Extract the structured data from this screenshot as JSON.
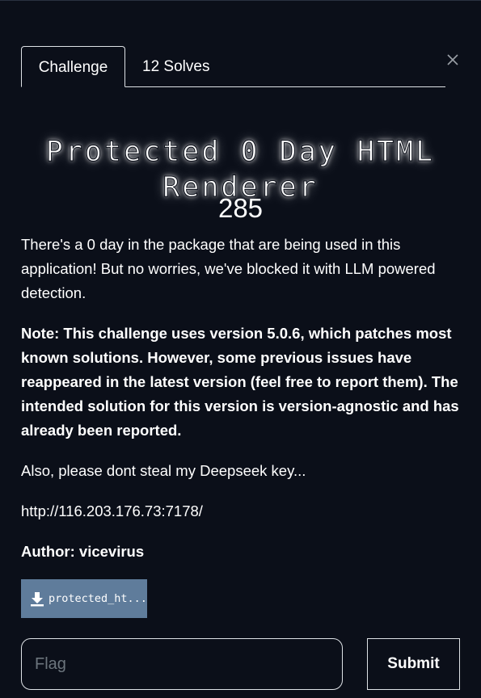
{
  "tabs": [
    {
      "label": "Challenge",
      "active": true
    },
    {
      "label": "12 Solves",
      "active": false
    }
  ],
  "challenge": {
    "title": "Protected 0 Day HTML Renderer",
    "points": "285",
    "description": "There's a 0 day in the package that are being used in this application! But no worries, we've blocked it with LLM powered detection.",
    "note": "Note: This challenge uses version 5.0.6, which patches most known solutions. However, some previous issues have reappeared in the latest version (feel free to report them). The intended solution for this version is version-agnostic and has already been reported.",
    "deepseek_line": "Also, please dont steal my Deepseek key...",
    "url": "http://116.203.176.73:7178/",
    "author": "Author: vicevirus",
    "file": {
      "name": "protected_ht...",
      "icon": "download-icon"
    }
  },
  "form": {
    "flag_placeholder": "Flag",
    "flag_value": "",
    "submit_label": "Submit"
  },
  "colors": {
    "background": "#0b0f19",
    "file_button": "#5f7c9b",
    "border": "#dee2e6"
  }
}
